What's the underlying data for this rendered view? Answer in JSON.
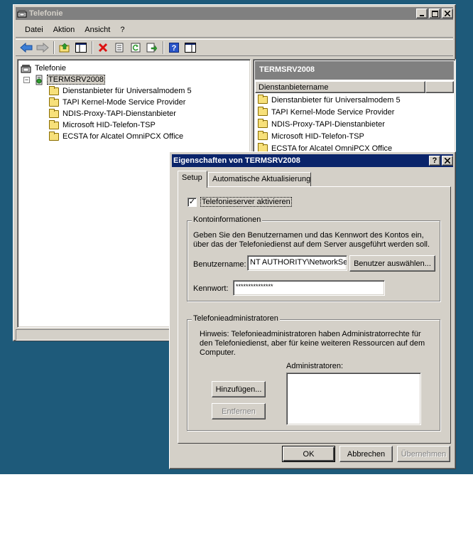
{
  "mmc": {
    "title": "Telefonie",
    "menu": [
      "Datei",
      "Aktion",
      "Ansicht",
      "?"
    ],
    "tree": {
      "root": "Telefonie",
      "server": "TERMSRV2008",
      "providers": [
        "Dienstanbieter für Universalmodem 5",
        "TAPI Kernel-Mode Service Provider",
        "NDIS-Proxy-TAPI-Dienstanbieter",
        "Microsoft HID-Telefon-TSP",
        "ECSTA for Alcatel OmniPCX Office"
      ]
    },
    "result": {
      "header": "TERMSRV2008",
      "column": "Dienstanbietername",
      "rows": [
        "Dienstanbieter für Universalmodem 5",
        "TAPI Kernel-Mode Service Provider",
        "NDIS-Proxy-TAPI-Dienstanbieter",
        "Microsoft HID-Telefon-TSP",
        "ECSTA for Alcatel OmniPCX Office"
      ]
    }
  },
  "dialog": {
    "title": "Eigenschaften von TERMSRV2008",
    "tabs": [
      "Setup",
      "Automatische Aktualisierung"
    ],
    "enable_checkbox": {
      "label": "Telefonieserver aktivieren",
      "checked": true
    },
    "account_group": {
      "title": "Kontoinformationen",
      "description_1": "Geben Sie den Benutzernamen und das Kennwort des Kontos ein,",
      "description_2": "über das der Telefoniedienst auf dem Server ausgeführt werden soll.",
      "username_label": "Benutzername:",
      "username_value": "NT AUTHORITY\\NetworkService",
      "select_user_button": "Benutzer auswählen...",
      "password_label": "Kennwort:",
      "password_value": "***************"
    },
    "admins_group": {
      "title": "Telefonieadministratoren",
      "hint_1": "Hinweis: Telefonieadministratoren haben Administratorrechte für",
      "hint_2": "den Telefoniedienst, aber für keine weiteren Ressourcen auf dem",
      "hint_3": "Computer.",
      "admins_label": "Administratoren:",
      "add_button": "Hinzufügen...",
      "remove_button": "Entfernen"
    },
    "ok_button": "OK",
    "cancel_button": "Abbrechen",
    "apply_button": "Übernehmen"
  }
}
